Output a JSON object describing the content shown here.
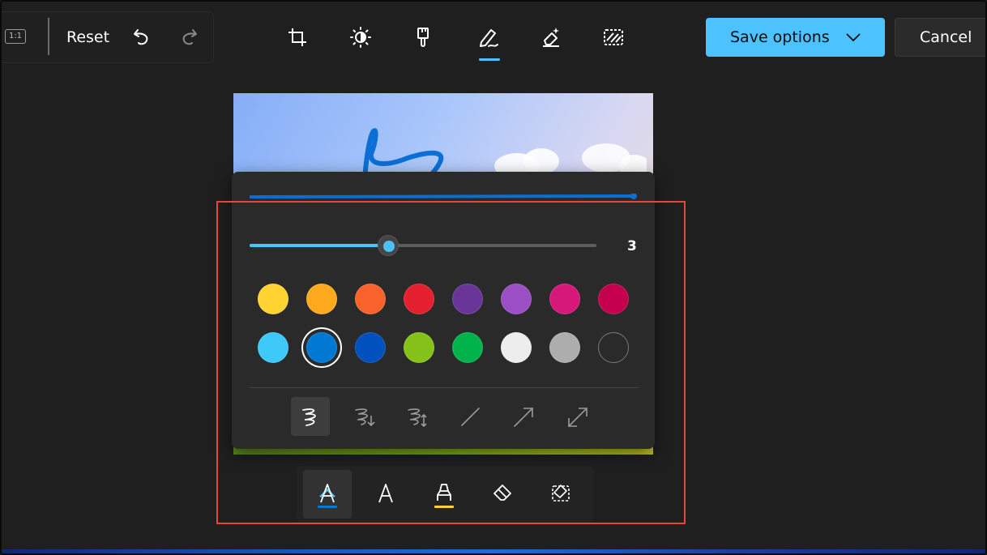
{
  "toolbar_left": {
    "aspect_label": "1:1",
    "reset_label": "Reset",
    "undo_icon": "undo-icon",
    "redo_icon": "redo-icon"
  },
  "toolbar_center": {
    "tools": [
      {
        "name": "crop",
        "icon": "crop-icon"
      },
      {
        "name": "adjust",
        "icon": "brightness-icon"
      },
      {
        "name": "filter",
        "icon": "brush-icon"
      },
      {
        "name": "markup",
        "icon": "pen-icon",
        "active": true
      },
      {
        "name": "erase",
        "icon": "magic-eraser-icon"
      },
      {
        "name": "background",
        "icon": "background-blur-icon"
      }
    ]
  },
  "toolbar_right": {
    "save_label": "Save options",
    "cancel_label": "Cancel"
  },
  "flyout": {
    "stroke_size_value": "3",
    "stroke_size_fraction": 0.4,
    "colors": [
      "#FFD432",
      "#FFAA1E",
      "#F7632A",
      "#E5202E",
      "#6A3599",
      "#9C4FC4",
      "#D6187A",
      "#C4004E",
      "#3FC9F8",
      "#0078D4",
      "#0050BD",
      "#84C219",
      "#00B34A",
      "#EDEDED",
      "#ADADAD",
      "transparent"
    ],
    "selected_color_index": 9,
    "stroke_styles": [
      {
        "name": "freehand",
        "icon": "freehand-stroke-icon",
        "active": true
      },
      {
        "name": "freehand-arrow-end",
        "icon": "freehand-arrow-icon"
      },
      {
        "name": "freehand-arrow-both",
        "icon": "freehand-double-arrow-icon"
      },
      {
        "name": "line",
        "icon": "line-icon"
      },
      {
        "name": "arrow",
        "icon": "arrow-icon"
      },
      {
        "name": "double-arrow",
        "icon": "double-arrow-icon"
      }
    ]
  },
  "pen_bar": {
    "tools": [
      {
        "name": "ballpoint-pen",
        "icon": "pen-tool-icon",
        "underline": "#0078D4",
        "active": true
      },
      {
        "name": "pen",
        "icon": "pen-tool-icon"
      },
      {
        "name": "highlighter",
        "icon": "highlighter-icon",
        "underline": "#FFD432"
      },
      {
        "name": "eraser",
        "icon": "eraser-icon"
      },
      {
        "name": "selection-eraser",
        "icon": "selection-eraser-icon"
      }
    ]
  },
  "colors": {
    "accent": "#4CC2FF",
    "annotation": "#E5473D",
    "panel": "#2A2A2A"
  }
}
